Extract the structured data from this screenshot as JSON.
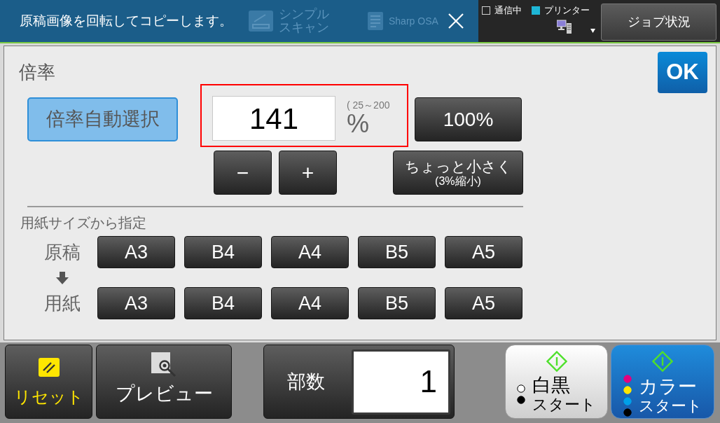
{
  "header": {
    "message": "原稿画像を回転してコピーします。",
    "background_items": [
      {
        "kind": "scan",
        "lines": [
          "シンプル",
          "スキャン"
        ]
      },
      {
        "kind": "app",
        "lines": [
          "Sharp OSA"
        ]
      }
    ],
    "indicators": [
      {
        "label": "通信中",
        "on": false
      },
      {
        "label": "プリンター",
        "on": true
      }
    ],
    "job_status": "ジョブ状況"
  },
  "magnification": {
    "title": "倍率",
    "ok": "OK",
    "auto_select": "倍率自動選択",
    "ratio_field": {
      "value": "141",
      "highlighted": true
    },
    "range": "( 25～200",
    "unit": "%",
    "preset": "100%",
    "decrease": "−",
    "increase": "+",
    "slightly_smaller": [
      "ちょっと小さく",
      "(3%縮小)"
    ]
  },
  "paper_size": {
    "title": "用紙サイズから指定",
    "rows": [
      {
        "label": "原稿",
        "sizes": [
          "A3",
          "B4",
          "A4",
          "B5",
          "A5"
        ]
      },
      {
        "label": "用紙",
        "sizes": [
          "A3",
          "B4",
          "A4",
          "B5",
          "A5"
        ]
      }
    ]
  },
  "footer": {
    "reset": "リセット",
    "preview": "プレビュー",
    "copies": {
      "label": "部数",
      "value": "1"
    },
    "start_buttons": [
      {
        "kind": "mono",
        "lines": [
          "白黒",
          "スタート"
        ]
      },
      {
        "kind": "color",
        "lines": [
          "カラー",
          "スタート"
        ]
      }
    ]
  }
}
